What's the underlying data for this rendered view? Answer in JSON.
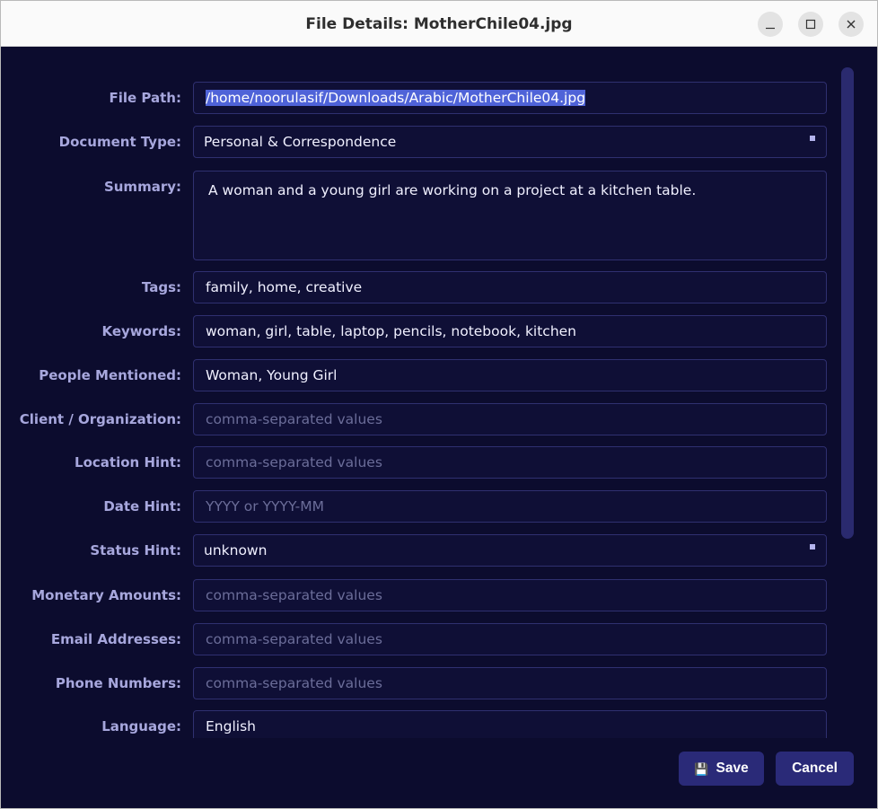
{
  "window": {
    "title": "File Details: MotherChile04.jpg"
  },
  "form": {
    "file_path": {
      "label": "File Path:",
      "value": "/home/noorulasif/Downloads/Arabic/MotherChile04.jpg"
    },
    "document_type": {
      "label": "Document Type:",
      "value": "Personal & Correspondence"
    },
    "summary": {
      "label": "Summary:",
      "value": "A woman and a young girl are working on a project at a kitchen table."
    },
    "tags": {
      "label": "Tags:",
      "value": "family, home, creative"
    },
    "keywords": {
      "label": "Keywords:",
      "value": "woman, girl, table, laptop, pencils, notebook, kitchen"
    },
    "people_mentioned": {
      "label": "People Mentioned:",
      "value": "Woman, Young Girl"
    },
    "client_organization": {
      "label": "Client / Organization:",
      "placeholder": "comma-separated values"
    },
    "location_hint": {
      "label": "Location Hint:",
      "placeholder": "comma-separated values"
    },
    "date_hint": {
      "label": "Date Hint:",
      "placeholder": "YYYY or YYYY-MM"
    },
    "status_hint": {
      "label": "Status Hint:",
      "value": "unknown"
    },
    "monetary_amounts": {
      "label": "Monetary Amounts:",
      "placeholder": "comma-separated values"
    },
    "email_addresses": {
      "label": "Email Addresses:",
      "placeholder": "comma-separated values"
    },
    "phone_numbers": {
      "label": "Phone Numbers:",
      "placeholder": "comma-separated values"
    },
    "language": {
      "label": "Language:",
      "value": "English"
    }
  },
  "buttons": {
    "save_label": "Save",
    "save_icon": "💾",
    "cancel_label": "Cancel"
  },
  "icons": {
    "minimize": "minimize-icon",
    "maximize": "maximize-icon",
    "close": "close-icon",
    "save": "floppy-disk-icon"
  },
  "colors": {
    "background": "#0c0c2e",
    "label": "#a7a7dd",
    "field_border": "#2f3070",
    "button": "#2a2a78",
    "selection": "#4f63d8"
  }
}
